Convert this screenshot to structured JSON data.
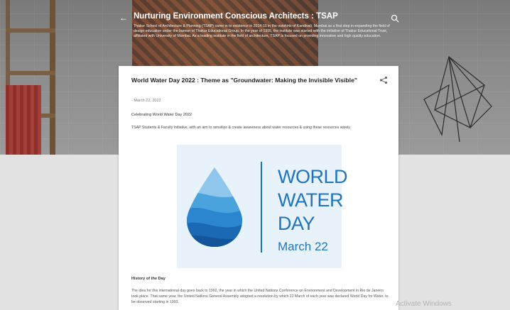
{
  "header": {
    "blog_title": "Nurturing Environment Conscious Architects : TSAP",
    "blog_description": "Thakur School of Architecture & Planning (TSAP) came in to existence in 2014-15 in the outskirts of Kandivali, Mumbai as a first step in expanding the field of design education under the banner of Thakur Educational Group. In the year of 1995, the institute was started with the initiative of Thakur Educational Trust, affiliated with University of Mumbai. As a leading institute in the field of architecture, TSAP is focused on providing innovative and high quality education."
  },
  "post": {
    "title": "World Water Day 2022 : Theme as \"Groundwater: Making the Invisible Visible\"",
    "date": "- March 22, 2022",
    "subheading": "Celebrating World Water Day 2022",
    "intro": "TSAP Students & Faculty initiative, with an aim to sensitize & create awareness about water resources & using these resources wisely.",
    "poster": {
      "line1": "WORLD",
      "line2": "WATER",
      "line3": "DAY",
      "date": "March 22",
      "colors": {
        "text": "#1f75bd",
        "background": "#e8f2fa"
      }
    },
    "history_heading": "History of the Day",
    "history_text": "The idea for this international day goes back to 1992, the year in which the United Nations Conference on Environment and Development in Rio de Janeiro took place. That same year, the United Nations General Assembly adopted a resolution by which 22 March of each year was declared World Day for Water, to be observed starting in 1993."
  },
  "watermark": "Activate Windows",
  "icons": {
    "back": "back-arrow-icon",
    "search": "search-icon",
    "share": "share-icon"
  }
}
